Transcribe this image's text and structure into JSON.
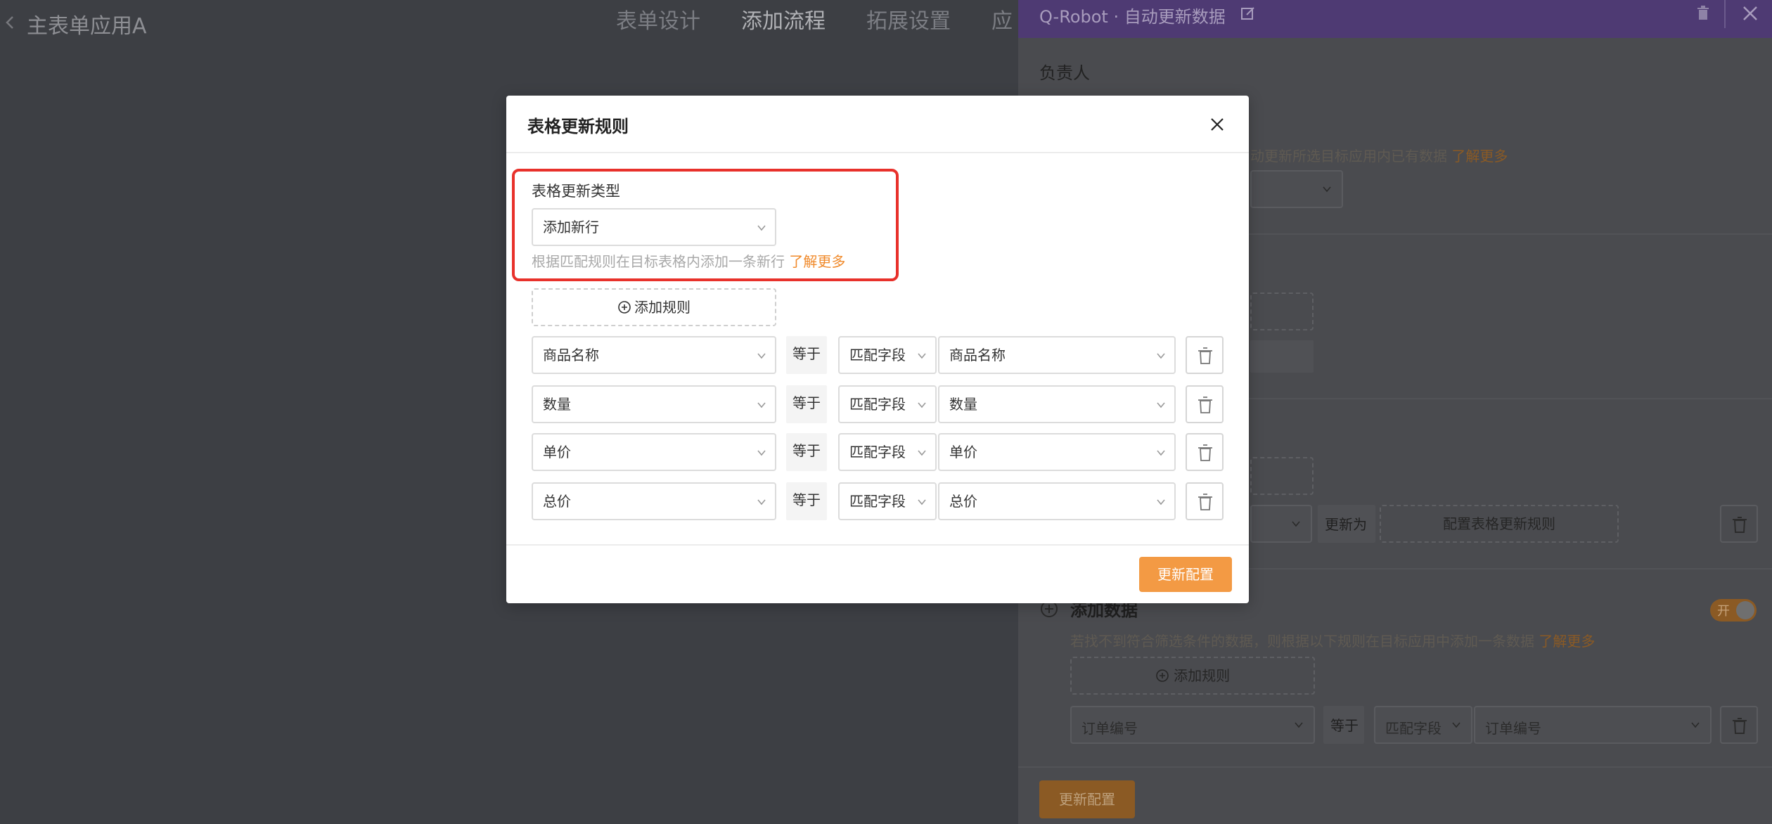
{
  "app": {
    "title": "主表单应用A",
    "tabs": [
      {
        "label": "表单设计"
      },
      {
        "label": "添加流程"
      },
      {
        "label": "拓展设置"
      },
      {
        "label": "应"
      }
    ]
  },
  "side_panel": {
    "title": "Q-Robot · 自动更新数据",
    "owner_label": "负责人",
    "hint_update": "动更新所选目标应用内已有数据",
    "learn_more": "了解更多",
    "update_to_label": "更新为",
    "config_rule_label": "配置表格更新规则",
    "add_data_title": "添加数据",
    "toggle_label": "开",
    "add_data_hint": "若找不到符合筛选条件的数据，则根据以下规则在目标应用中添加一条数据",
    "add_rule_label": "添加规则",
    "rule": {
      "left": "订单编号",
      "op": "等于",
      "type": "匹配字段",
      "right": "订单编号"
    },
    "primary_button": "更新配置"
  },
  "modal": {
    "title": "表格更新规则",
    "type_label": "表格更新类型",
    "type_value": "添加新行",
    "type_hint": "根据匹配规则在目标表格内添加一条新行",
    "learn_more": "了解更多",
    "add_rule_label": "添加规则",
    "rules": [
      {
        "left": "商品名称",
        "op": "等于",
        "type": "匹配字段",
        "right": "商品名称"
      },
      {
        "left": "数量",
        "op": "等于",
        "type": "匹配字段",
        "right": "数量"
      },
      {
        "left": "单价",
        "op": "等于",
        "type": "匹配字段",
        "right": "单价"
      },
      {
        "left": "总价",
        "op": "等于",
        "type": "匹配字段",
        "right": "总价"
      }
    ],
    "primary_button": "更新配置"
  },
  "colors": {
    "accent": "#f39a44",
    "link": "#f08a2b",
    "highlight": "#e8312b",
    "panel_header": "#4e3a73"
  },
  "icons": [
    "chevron-left-icon",
    "edit-icon",
    "trash-icon",
    "close-icon",
    "chevron-down-icon",
    "plus-circle-icon"
  ]
}
